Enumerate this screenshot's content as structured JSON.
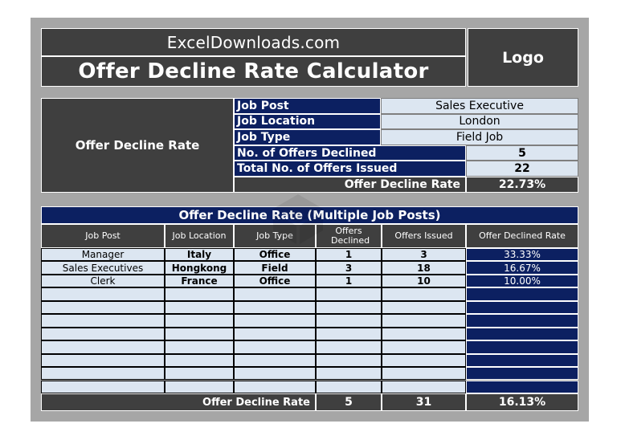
{
  "header": {
    "site": "ExcelDownloads.com",
    "title": "Offer Decline Rate Calculator",
    "logo": "Logo"
  },
  "single": {
    "section_label": "Offer Decline Rate",
    "fields": [
      {
        "label": "Job Post",
        "value": "Sales Executive"
      },
      {
        "label": "Job Location",
        "value": "London"
      },
      {
        "label": "Job Type",
        "value": "Field Job"
      },
      {
        "label": "No. of Offers Declined",
        "value": "5"
      },
      {
        "label": "Total No. of Offers Issued",
        "value": "22"
      }
    ],
    "result_label": "Offer Decline Rate",
    "result_value": "22.73%"
  },
  "multiple": {
    "title": "Offer Decline Rate (Multiple Job Posts)",
    "columns": [
      "Job Post",
      "Job Location",
      "Job Type",
      "Offers Declined",
      "Offers Issued",
      "Offer Declined Rate"
    ],
    "rows": [
      [
        "Manager",
        "Italy",
        "Office",
        "1",
        "3",
        "33.33%"
      ],
      [
        "Sales Executives",
        "Hongkong",
        "Field",
        "3",
        "18",
        "16.67%"
      ],
      [
        "Clerk",
        "France",
        "Office",
        "1",
        "10",
        "10.00%"
      ],
      [
        "",
        "",
        "",
        "",
        "",
        ""
      ],
      [
        "",
        "",
        "",
        "",
        "",
        ""
      ],
      [
        "",
        "",
        "",
        "",
        "",
        ""
      ],
      [
        "",
        "",
        "",
        "",
        "",
        ""
      ],
      [
        "",
        "",
        "",
        "",
        "",
        ""
      ],
      [
        "",
        "",
        "",
        "",
        "",
        ""
      ],
      [
        "",
        "",
        "",
        "",
        "",
        ""
      ],
      [
        "",
        "",
        "",
        "",
        "",
        ""
      ]
    ],
    "total_label": "Offer Decline Rate",
    "total_declined": "5",
    "total_issued": "31",
    "total_rate": "16.13%"
  },
  "colors": {
    "dark": "#3f3f3f",
    "navy": "#0c2061",
    "light": "#dce6f1",
    "gray": "#a6a6a6"
  }
}
